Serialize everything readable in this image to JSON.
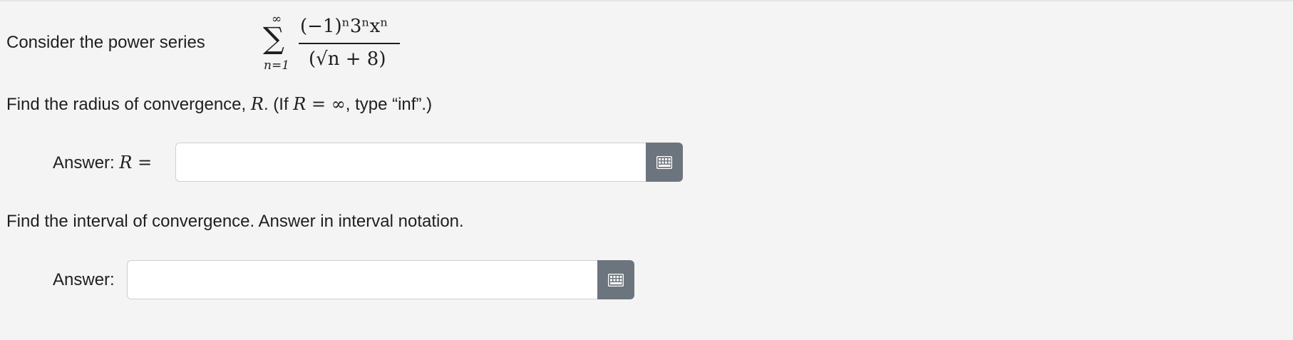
{
  "problem": {
    "consider_text": "Consider the power series",
    "series": {
      "upper_limit": "∞",
      "sigma": "∑",
      "lower_limit": "n=1",
      "numerator": "(−1)ⁿ3ⁿxⁿ",
      "denominator": "(√n + 8)"
    },
    "radius_question": {
      "prefix": "Find the radius of convergence, ",
      "var": "R",
      "mid": ". (If ",
      "cond": "R = ∞",
      "suffix": ", type “inf”.)"
    },
    "interval_question": "Find the interval of convergence. Answer in interval notation."
  },
  "answer1": {
    "label": "Answer: ",
    "label_math": "R =",
    "value": "",
    "placeholder": ""
  },
  "answer2": {
    "label": "Answer:",
    "value": "",
    "placeholder": ""
  },
  "icons": {
    "keyboard_button": "math-keyboard-icon"
  },
  "colors": {
    "background": "#f4f4f4",
    "button": "#6c757d",
    "input_border": "#cfcfcf"
  }
}
